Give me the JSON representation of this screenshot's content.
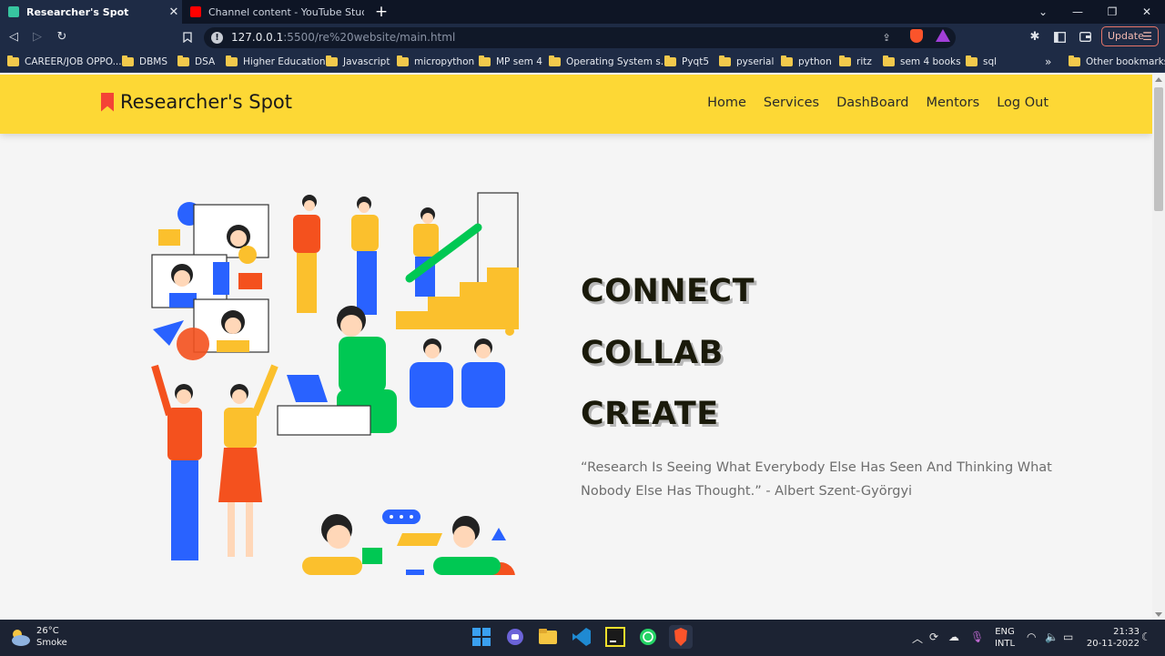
{
  "browser": {
    "tabs": [
      {
        "title": "Researcher's Spot",
        "active": true
      },
      {
        "title": "Channel content - YouTube Studio",
        "active": false
      }
    ],
    "new_tab": "+",
    "window_controls": {
      "dropdown": "⌄",
      "minimize": "—",
      "restore": "❐",
      "close": "✕"
    },
    "url_host": "127.0.0.1",
    "url_rest": ":5500/re%20website/main.html",
    "update_label": "Update",
    "bookmarks": [
      "CAREER/JOB OPPO...",
      "DBMS",
      "DSA",
      "Higher Education",
      "Javascript",
      "micropython",
      "MP sem 4",
      "Operating System s...",
      "Pyqt5",
      "pyserial",
      "python",
      "ritz",
      "sem 4 books",
      "sql"
    ],
    "bookmarks_overflow": "»",
    "other_bookmarks": "Other bookmarks"
  },
  "site": {
    "brand": "Researcher's Spot",
    "brand_color": "#f44336",
    "navbar_color": "#fdd835",
    "nav": [
      "Home",
      "Services",
      "DashBoard",
      "Mentors",
      "Log Out"
    ],
    "hero": {
      "lines": [
        "CONNECT",
        "COLLAB",
        "CREATE"
      ],
      "quote": "“Research Is Seeing What Everybody Else Has Seen And Thinking What Nobody Else Has Thought.” - Albert Szent-Györgyi"
    }
  },
  "taskbar": {
    "weather_temp": "26°C",
    "weather_desc": "Smoke",
    "language_1": "ENG",
    "language_2": "INTL",
    "time": "21:33",
    "date": "20-11-2022"
  }
}
